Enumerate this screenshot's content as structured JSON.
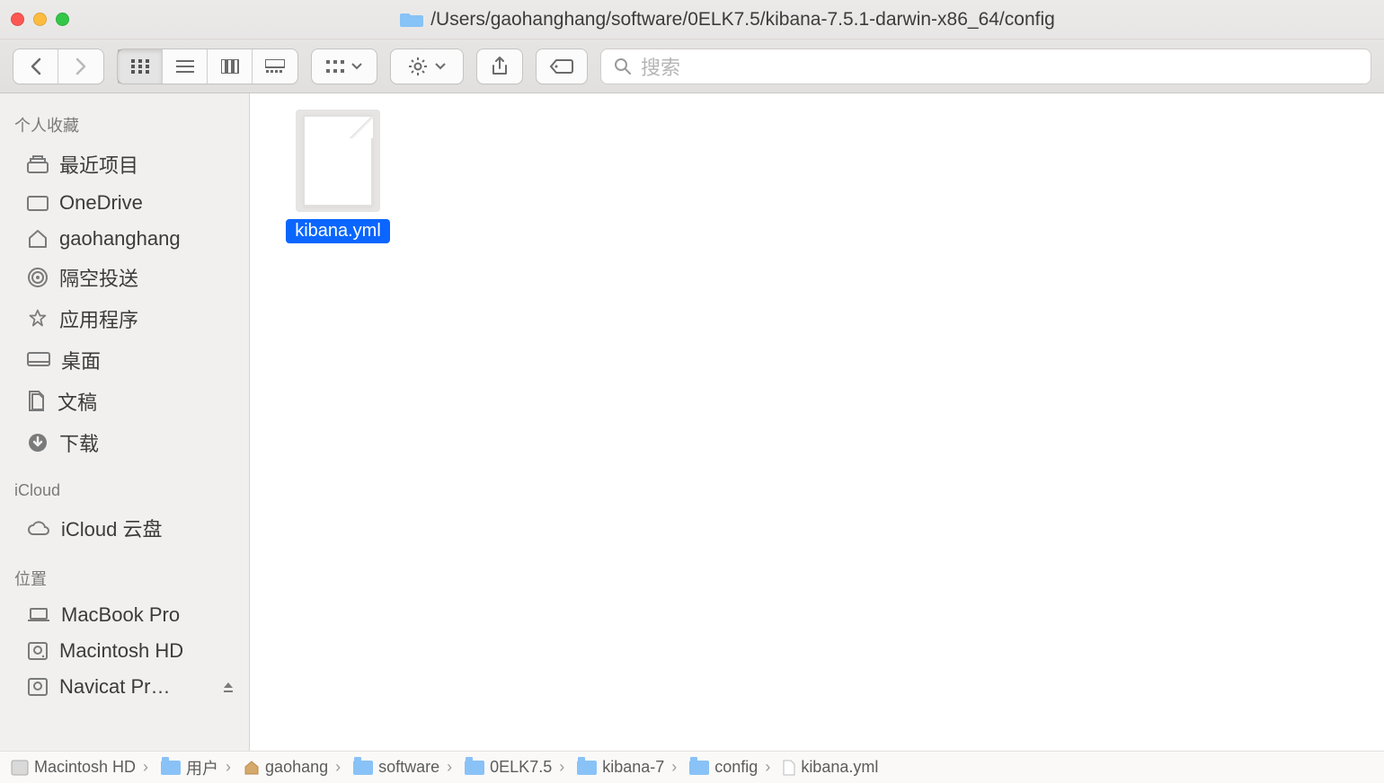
{
  "title_path": "/Users/gaohanghang/software/0ELK7.5/kibana-7.5.1-darwin-x86_64/config",
  "search": {
    "placeholder": "搜索"
  },
  "sidebar": {
    "sections": {
      "favorites": {
        "title": "个人收藏"
      },
      "icloud": {
        "title": "iCloud"
      },
      "locations": {
        "title": "位置"
      }
    },
    "favorites": [
      {
        "label": "最近项目",
        "icon": "recents"
      },
      {
        "label": "OneDrive",
        "icon": "folder"
      },
      {
        "label": "gaohanghang",
        "icon": "home"
      },
      {
        "label": "隔空投送",
        "icon": "airdrop"
      },
      {
        "label": "应用程序",
        "icon": "apps"
      },
      {
        "label": "桌面",
        "icon": "desktop"
      },
      {
        "label": "文稿",
        "icon": "documents"
      },
      {
        "label": "下载",
        "icon": "downloads"
      }
    ],
    "icloud": [
      {
        "label": "iCloud 云盘",
        "icon": "cloud"
      }
    ],
    "locations": [
      {
        "label": "MacBook Pro",
        "icon": "laptop"
      },
      {
        "label": "Macintosh HD",
        "icon": "hdd"
      },
      {
        "label": "Navicat Pr…",
        "icon": "hdd"
      }
    ]
  },
  "files": [
    {
      "name": "kibana.yml",
      "selected": true
    }
  ],
  "pathbar": [
    {
      "label": "Macintosh HD",
      "icon": "hdd"
    },
    {
      "label": "用户",
      "icon": "folder"
    },
    {
      "label": "gaohang",
      "icon": "home"
    },
    {
      "label": "software",
      "icon": "folder"
    },
    {
      "label": "0ELK7.5",
      "icon": "folder"
    },
    {
      "label": "kibana-7",
      "icon": "folder"
    },
    {
      "label": "config",
      "icon": "folder"
    },
    {
      "label": "kibana.yml",
      "icon": "doc"
    }
  ]
}
